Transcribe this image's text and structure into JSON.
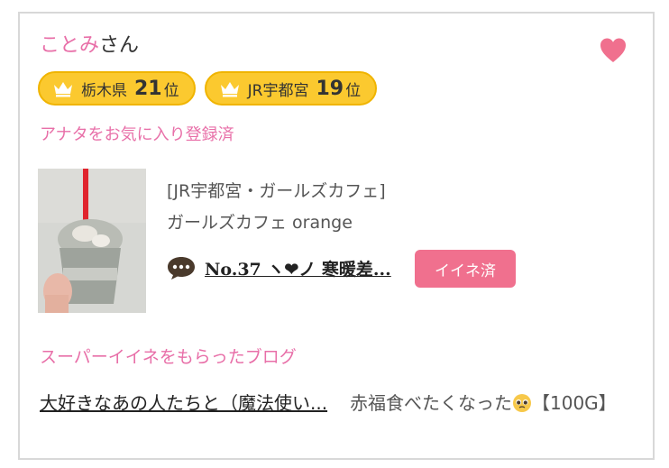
{
  "profile": {
    "name": "ことみ",
    "suffix": "さん",
    "favorite_icon": "heart-icon",
    "accent_color": "#e86fa8",
    "heart_color": "#f0708e"
  },
  "rankings": [
    {
      "area": "栃木県",
      "rank": "21",
      "unit": "位",
      "icon": "crown-icon"
    },
    {
      "area": "JR宇都宮",
      "rank": "19",
      "unit": "位",
      "icon": "crown-icon"
    }
  ],
  "favorite_status": "アナタをお気に入り登録済",
  "shop": {
    "category": "[JR宇都宮・ガールズカフェ]",
    "name": "ガールズカフェ orange"
  },
  "blog": {
    "title": "No.37 ヽ❤ノ 寒暖差...",
    "icon": "speech-bubble-icon",
    "iine_label": "イイネ済"
  },
  "super_iine": {
    "label": "スーパーイイネをもらったブログ",
    "link_text": "大好きなあの人たちと（魔法使い...",
    "desc_before": "赤福食べたくなった",
    "desc_after": "【100G】",
    "emoji_icon": "pleading-face-icon"
  }
}
